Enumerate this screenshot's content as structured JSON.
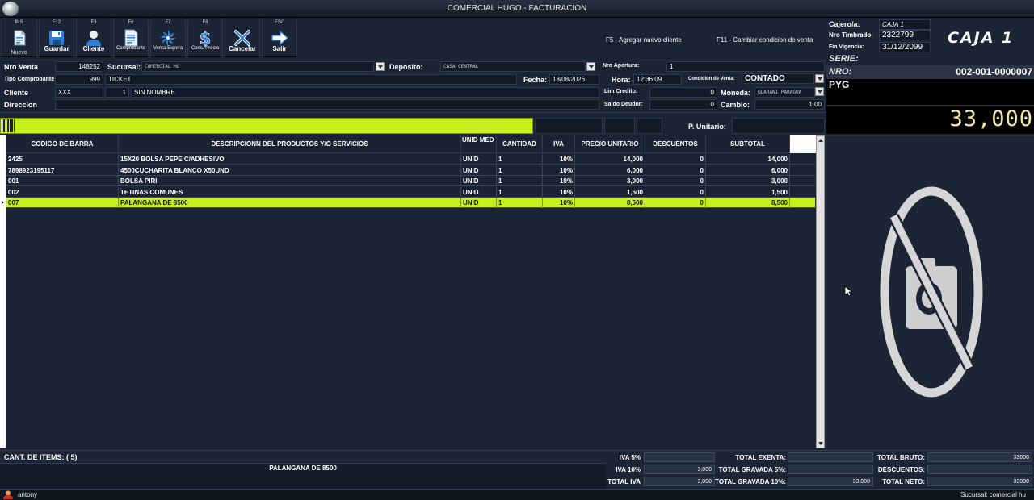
{
  "window": {
    "title": "COMERCIAL HUGO - FACTURACION"
  },
  "toolbar": [
    {
      "key": "INS",
      "label": "Nuevo",
      "icon": "new-document-icon"
    },
    {
      "key": "F12",
      "label": "Guardar",
      "icon": "save-icon"
    },
    {
      "key": "F3",
      "label": "Cliente",
      "icon": "user-icon"
    },
    {
      "key": "F6",
      "label": "Comprobante",
      "icon": "receipt-icon"
    },
    {
      "key": "F7",
      "label": "Venta-Espera",
      "icon": "hold-sale-icon"
    },
    {
      "key": "F8",
      "label": "Cons. Precio",
      "icon": "price-check-icon"
    },
    {
      "key": "",
      "label": "Cancelar",
      "icon": "cancel-icon"
    },
    {
      "key": "ESC",
      "label": "Salir",
      "icon": "exit-icon"
    }
  ],
  "hints": {
    "f5": "F5  - Agregar nuevo cliente",
    "f11": "F11 - Cambiar condicion de venta"
  },
  "form": {
    "nro_venta_label": "Nro Venta",
    "nro_venta": "148252",
    "sucursal_label": "Sucursal:",
    "sucursal": "COMERCIAL HU",
    "deposito_label": "Deposito:",
    "deposito": "CASA CENTRAL",
    "nro_apertura_label": "Nro Apertura:",
    "nro_apertura": "1",
    "tipo_comprobante_label": "Tipo Comprobante",
    "tipo_code": "999",
    "tipo": "TICKET",
    "fecha_label": "Fecha:",
    "fecha": "18/08/2026",
    "hora_label": "Hora:",
    "hora": "12:36:09",
    "condicion_label": "Condicion de Venta:",
    "condicion": "CONTADO",
    "cliente_label": "Cliente",
    "cliente_code": "XXX",
    "cliente_num": "1",
    "cliente_nombre": "SIN NOMBRE",
    "lim_credito_label": "Lim Credito:",
    "lim_credito": "0",
    "moneda_label": "Moneda:",
    "moneda": "GUARANI PARAGUA",
    "direccion_label": "Direccion",
    "direccion": "",
    "saldo_deudor_label": "Saldo Deudor:",
    "saldo_deudor": "0",
    "cambio_label": "Cambio:",
    "cambio": "1.00",
    "p_unitario_label": "P. Unitario:"
  },
  "grid": {
    "headers": [
      "CODIGO DE BARRA",
      "DESCRIPCIONN DEL PRODUCTOS Y/O SERVICIOS",
      "UNID MED",
      "CANTIDAD",
      "IVA",
      "PRECIO UNITARIO",
      "DESCUENTOS",
      "SUBTOTAL"
    ],
    "rows": [
      [
        "2425",
        "15X20 BOLSA PEPE C/ADHESIVO",
        "UNID",
        "1",
        "10%",
        "14,000",
        "0",
        "14,000"
      ],
      [
        "7898923195117",
        "4500CUCHARITA BLANCO X50UND",
        "UNID",
        "1",
        "10%",
        "6,000",
        "0",
        "6,000"
      ],
      [
        "001",
        "BOLSA PIRI",
        "UNID",
        "1",
        "10%",
        "3,000",
        "0",
        "3,000"
      ],
      [
        "002",
        "TETINAS COMUNES",
        "UNID",
        "1",
        "10%",
        "1,500",
        "0",
        "1,500"
      ],
      [
        "007",
        "PALANGANA DE 8500",
        "UNID",
        "1",
        "10%",
        "8,500",
        "0",
        "8,500"
      ]
    ],
    "selected_row": 4
  },
  "right": {
    "cajero_label": "Cajero/a:",
    "cajero": "CAJA 1",
    "timbrado_label": "Nro Timbrado:",
    "timbrado": "2322799",
    "vigencia_label": "Fin Vigencia:",
    "vigencia": "31/12/2099",
    "caja_title": "CAJA 1",
    "serie_label": "SERIE:",
    "nro_label": "NRO:",
    "nro": "002-001-0000007",
    "currency": "PYG",
    "total": "33,000"
  },
  "footer": {
    "items_label": "CANT. DE ITEMS:",
    "items_count": "( 5)",
    "current_item": "PALANGANA DE 8500",
    "iva5_label": "IVA 5%",
    "iva5": "",
    "iva10_label": "IVA 10%",
    "iva10": "3,000",
    "total_iva_label": "TOTAL IVA",
    "total_iva": "3,000",
    "exenta_label": "TOTAL EXENTA:",
    "exenta": "",
    "gravada5_label": "TOTAL GRAVADA 5%:",
    "gravada5": "",
    "gravada10_label": "TOTAL GRAVADA 10%:",
    "gravada10": "33,000",
    "bruto_label": "TOTAL BRUTO:",
    "bruto": "33000",
    "descuentos_label": "DESCUENTOS:",
    "descuentos": "",
    "neto_label": "TOTAL NETO:",
    "neto": "33000"
  },
  "status": {
    "user": "antony",
    "sucursal": "Sucursal: comercial hu"
  },
  "colors": {
    "accent": "#c8ef1e",
    "background": "#1b2434",
    "toolbar_icon": "#2f7fd8"
  }
}
